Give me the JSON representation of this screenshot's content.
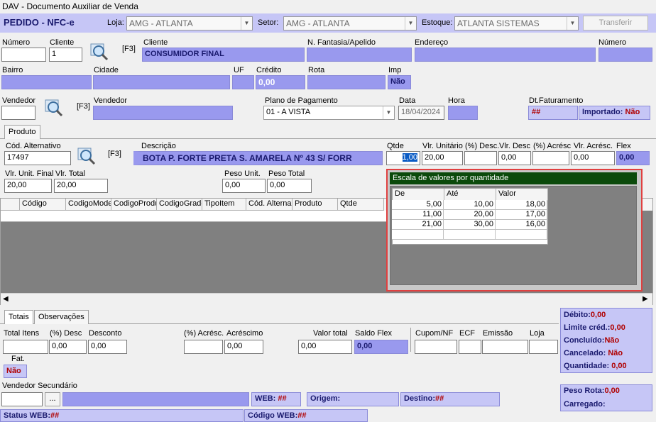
{
  "window": {
    "title": "DAV - Documento Auxiliar de Venda"
  },
  "header": {
    "title": "PEDIDO - NFC-e",
    "loja_label": "Loja:",
    "loja_value": "AMG - ATLANTA",
    "setor_label": "Setor:",
    "setor_value": "AMG - ATLANTA",
    "estoque_label": "Estoque:",
    "estoque_value": "ATLANTA SISTEMAS",
    "transferir_label": "Transferir"
  },
  "cliente": {
    "numero_label": "Número",
    "numero_value": "",
    "cliente_label": "Cliente",
    "cliente_value": "1",
    "f3": "[F3]",
    "nome_label": "Cliente",
    "nome_value": "CONSUMIDOR FINAL",
    "fantasia_label": "N. Fantasia/Apelido",
    "fantasia_value": "",
    "endereco_label": "Endereço",
    "endereco_value": "",
    "numero2_label": "Número",
    "numero2_value": "",
    "bairro_label": "Bairro",
    "cidade_label": "Cidade",
    "uf_label": "UF",
    "credito_label": "Crédito",
    "credito_value": "0,00",
    "rota_label": "Rota",
    "imp_label": "Imp",
    "imp_value": "Não"
  },
  "vendedor": {
    "vendedor_label": "Vendedor",
    "f3": "[F3]",
    "vendedor_nome_label": "Vendedor",
    "plano_label": "Plano de Pagamento",
    "plano_value": "01 - A VISTA",
    "data_label": "Data",
    "data_value": "18/04/2024",
    "hora_label": "Hora",
    "dtfat_label": "Dt.Faturamento",
    "dtfat_value": "##",
    "importado_label": "Importado:",
    "importado_value": "Não"
  },
  "produto": {
    "tab_label": "Produto",
    "cod_alt_label": "Cód. Alternativo",
    "cod_alt_value": "17497",
    "f3": "[F3]",
    "descricao_label": "Descrição",
    "descricao_value": "BOTA P. FORTE PRETA S. AMARELA Nº 43 S/ FORR",
    "qtde_label": "Qtde",
    "qtde_value": "1,00",
    "vlr_unit_label": "Vlr. Unitário",
    "vlr_unit_value": "20,00",
    "pct_desc_label": "(%) Desc.",
    "pct_desc_value": "",
    "vlr_desc_label": "Vlr. Desc",
    "vlr_desc_value": "0,00",
    "pct_acresc_label": "(%) Acrésc",
    "pct_acresc_value": "",
    "vlr_acresc_label": "Vlr. Acrésc.",
    "vlr_acresc_value": "0,00",
    "flex_label": "Flex",
    "flex_value": "0,00",
    "vlr_unit_final_label": "Vlr. Unit. Final",
    "vlr_unit_final_value": "20,00",
    "vlr_total_label": "Vlr. Total",
    "vlr_total_value": "20,00",
    "peso_unit_label": "Peso Unit.",
    "peso_unit_value": "0,00",
    "peso_total_label": "Peso Total",
    "peso_total_value": "0,00"
  },
  "grid": {
    "columns": [
      "Código",
      "CodigoMode",
      "CodigoProdu",
      "CodigoGrade",
      "TipoItem",
      "Cód. Alterna",
      "Produto",
      "Qtde"
    ]
  },
  "escala": {
    "title": "Escala de valores por quantidade",
    "columns": [
      "De",
      "Até",
      "Valor"
    ],
    "rows": [
      [
        "5,00",
        "10,00",
        "18,00"
      ],
      [
        "11,00",
        "20,00",
        "17,00"
      ],
      [
        "21,00",
        "30,00",
        "16,00"
      ]
    ]
  },
  "totais": {
    "tab_totais": "Totais",
    "tab_obs": "Observações",
    "total_itens_label": "Total Itens",
    "total_itens_value": "",
    "pct_desc_label": "(%) Desc",
    "pct_desc_value": "0,00",
    "desconto_label": "Desconto",
    "desconto_value": "0,00",
    "pct_acresc_label": "(%) Acrésc.",
    "pct_acresc_value": "",
    "acrescimo_label": "Acréscimo",
    "acrescimo_value": "0,00",
    "valor_total_label": "Valor total",
    "valor_total_value": "0,00",
    "saldo_flex_label": "Saldo Flex",
    "saldo_flex_value": "0,00",
    "cupom_label": "Cupom/NF",
    "ecf_label": "ECF",
    "emissao_label": "Emissão",
    "loja_label": "Loja",
    "fat_label": "Fat.",
    "fat_value": "Não"
  },
  "status": {
    "debito_label": "Débito:",
    "debito_value": "0,00",
    "limite_label": "Limite créd.:",
    "limite_value": "0,00",
    "concluido_label": "Concluído:",
    "concluido_value": "Não",
    "cancelado_label": "Cancelado:",
    "cancelado_value": "Não",
    "quantidade_label": "Quantidade:",
    "quantidade_value": "0,00",
    "peso_rota_label": "Peso Rota:",
    "peso_rota_value": "0,00",
    "carregado_label": "Carregado:"
  },
  "footer": {
    "vend_sec_label": "Vendedor Secundário",
    "ellipsis": "...",
    "web_label": "WEB:",
    "web_value": "##",
    "origem_label": "Origem:",
    "destino_label": "Destino:",
    "destino_value": "##",
    "status_web_label": "Status WEB:",
    "status_web_value": "##",
    "codigo_web_label": "Código WEB:",
    "codigo_web_value": "##"
  }
}
